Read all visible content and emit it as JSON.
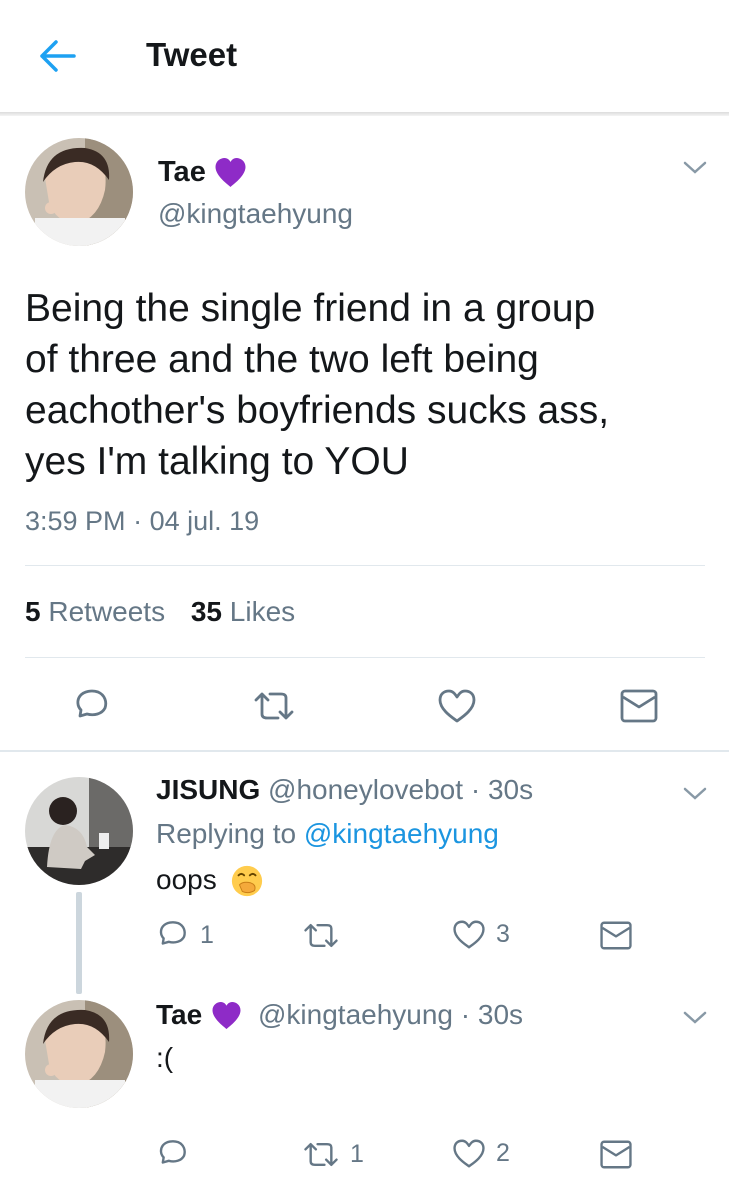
{
  "header": {
    "title": "Tweet"
  },
  "main_tweet": {
    "display_name": "Tae",
    "handle": "@kingtaehyung",
    "text_lines": [
      "Being the single friend in a group",
      "of three and the two left being",
      "eachother's boyfriends sucks ass,",
      "yes I'm talking to YOU"
    ],
    "time": "3:59 PM",
    "date": "04 jul. 19",
    "retweets_count": "5",
    "retweets_label": "Retweets",
    "likes_count": "35",
    "likes_label": "Likes"
  },
  "replies": [
    {
      "display_name": "JISUNG",
      "handle": "@honeylovebot",
      "time": "30s",
      "replying_prefix": "Replying to",
      "replying_to": "@kingtaehyung",
      "text": "oops",
      "reply_count": "1",
      "retweet_count": "",
      "like_count": "3"
    },
    {
      "display_name": "Tae",
      "handle": "@kingtaehyung",
      "time": "30s",
      "text": ":(",
      "reply_count": "",
      "retweet_count": "1",
      "like_count": "2"
    }
  ],
  "colors": {
    "accent": "#1da1f2",
    "heart_emoji": "#8e2bc7",
    "muted_text": "#657786",
    "divider": "#e1e8ed"
  }
}
